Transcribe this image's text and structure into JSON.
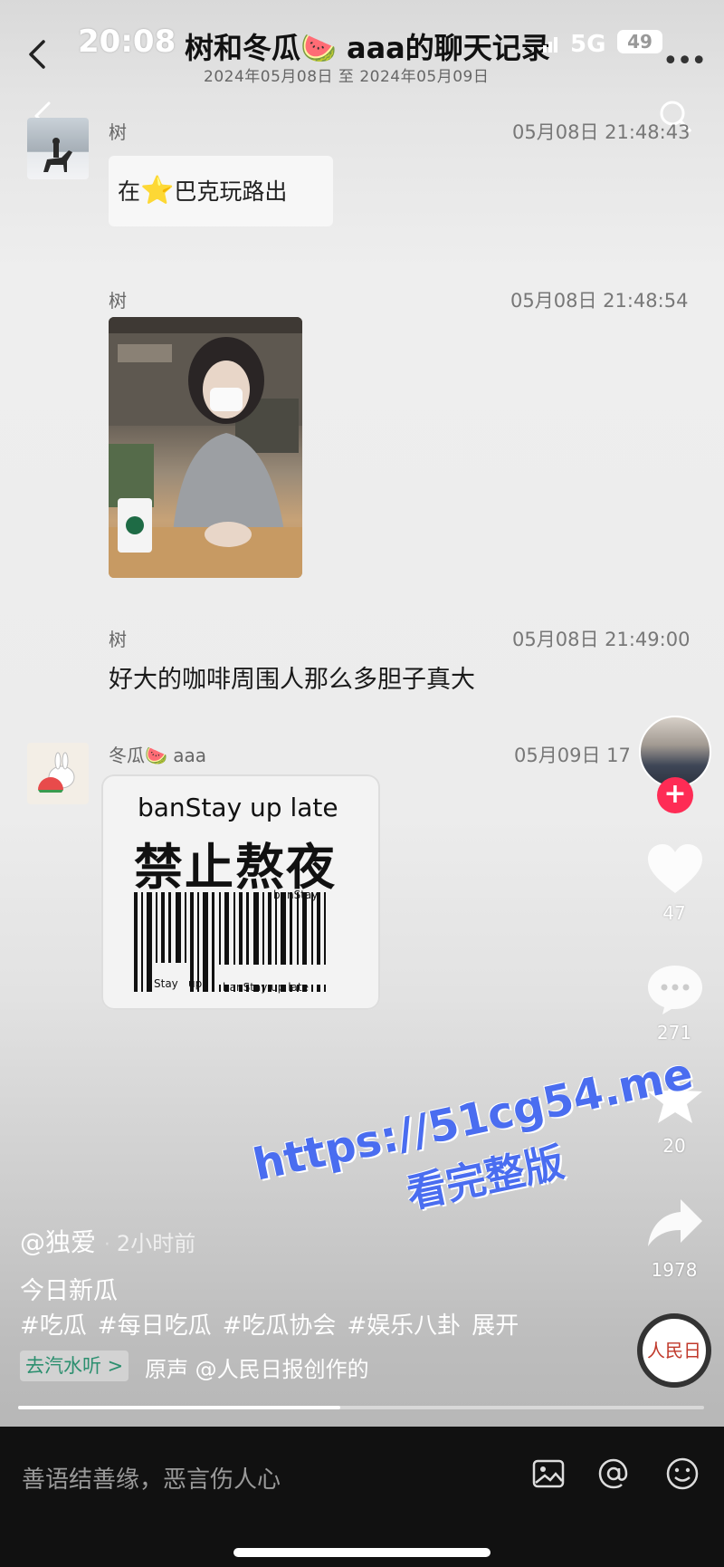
{
  "status_bar": {
    "time": "20:08",
    "network": "5G",
    "battery": "49"
  },
  "chat": {
    "title": "树和冬瓜🍉 aaa的聊天记录",
    "date_range": "2024年05月08日 至 2024年05月09日",
    "messages": [
      {
        "sender": "树",
        "time": "05月08日 21:48:43",
        "text_before": "在",
        "text_after": "巴克玩路出"
      },
      {
        "sender": "树",
        "time": "05月08日 21:48:54"
      },
      {
        "sender": "树",
        "time": "05月08日 21:49:00",
        "text": "好大的咖啡周围人那么多胆子真大"
      },
      {
        "sender": "冬瓜🍉 aaa",
        "time": "05月09日 17"
      }
    ],
    "sticker": {
      "line1": "banStay up late",
      "big": "禁止熬夜",
      "small_1": "banStay",
      "small_2": "Stay",
      "small_3": "up l",
      "small_4": "banStay up late"
    }
  },
  "right_rail": {
    "likes": "47",
    "comments": "271",
    "favorites": "20",
    "shares": "1978"
  },
  "post": {
    "author": "@独爱",
    "posted": "2小时前",
    "caption": "今日新瓜",
    "tags": [
      "#吃瓜",
      "#每日吃瓜",
      "#吃瓜协会",
      "#娱乐八卦"
    ],
    "expand": "展开",
    "listen_chip": "去汽水听 >",
    "sound": "原声    @人民日报创作的",
    "progress": 0.47
  },
  "watermark": {
    "url": "https://51cg54.me",
    "cta": "看完整版"
  },
  "comment_bar": {
    "placeholder": "善语结善缘，恶言伤人心"
  },
  "icons": [
    "back-icon",
    "more-icon",
    "search-icon",
    "heart-icon",
    "comment-icon",
    "star-icon",
    "share-icon",
    "image-icon",
    "at-icon",
    "emoji-icon"
  ]
}
